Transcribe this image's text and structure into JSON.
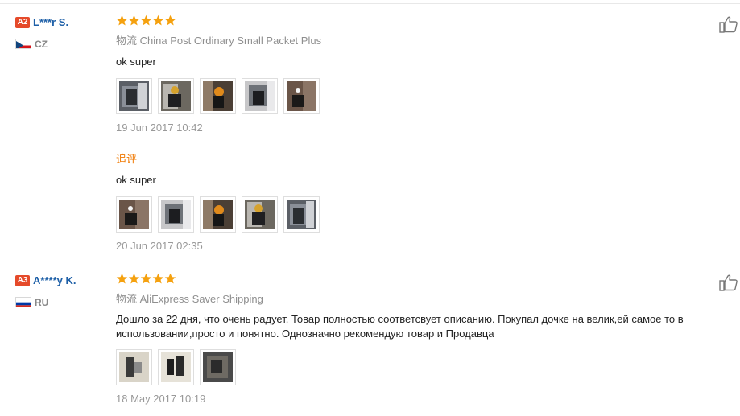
{
  "reviews": [
    {
      "level": "A2",
      "username": "L***r S.",
      "country": "CZ",
      "rating": 5,
      "shipping_label": "物流",
      "shipping": "China Post Ordinary Small Packet Plus",
      "text": "ok super",
      "photos": [
        "photo-1",
        "photo-2",
        "photo-3",
        "photo-4",
        "photo-5"
      ],
      "date": "19 Jun 2017 10:42",
      "followup": {
        "label": "追评",
        "text": "ok super",
        "photos": [
          "photo-1",
          "photo-2",
          "photo-3",
          "photo-4",
          "photo-5"
        ],
        "date": "20 Jun 2017 02:35"
      }
    },
    {
      "level": "A3",
      "username": "A****y K.",
      "country": "RU",
      "rating": 5,
      "shipping_label": "物流",
      "shipping": "AliExpress Saver Shipping",
      "text": "Дошло за 22 дня, что очень радует. Товар полностью соответсвует описанию. Покупал дочке на велик,ей самое то в использовании,просто и понятно. Однозначно рекомендую товар и Продавца",
      "photos": [
        "photo-1",
        "photo-2",
        "photo-3"
      ],
      "date": "18 May 2017 10:19"
    }
  ],
  "icons": {
    "star": "star-icon",
    "like": "thumbs-up-icon"
  },
  "colors": {
    "star": "#f5a10f",
    "username": "#1d5fa7",
    "level_badge": "#e54a2a",
    "followup_label": "#f07800"
  }
}
